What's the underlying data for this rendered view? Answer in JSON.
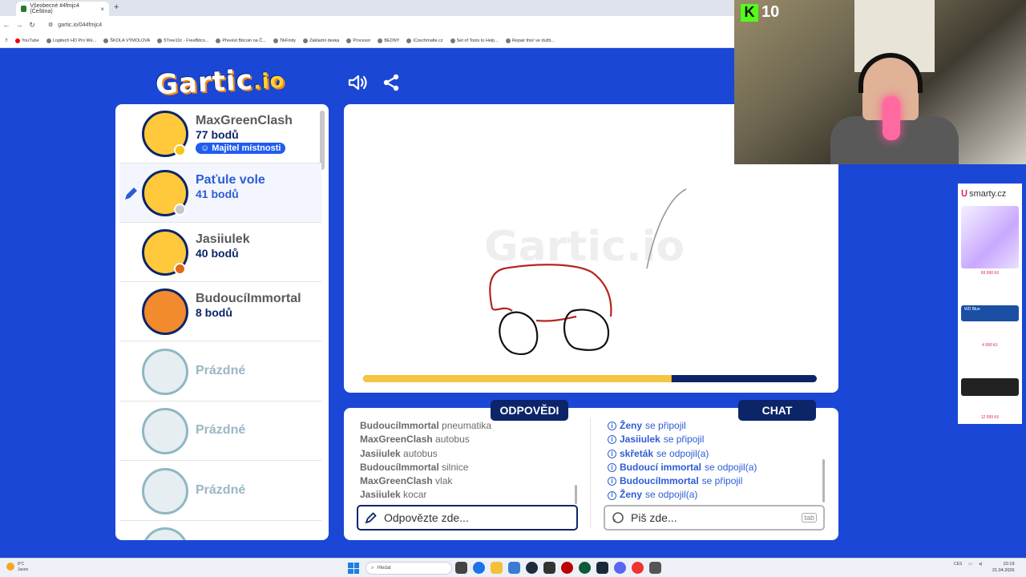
{
  "browser": {
    "tab_title": "Všeobecné #4fmjc4 (Čeština)",
    "url": "gartic.io/044fmjc4",
    "bookmarks": [
      "YouTube",
      "Logitech HD Pro We...",
      "ŠKOLA VÝMOLOVA",
      "5Tree10c - FreeBitco...",
      "Převést Bitcoin na Č...",
      "TikFinity",
      "Základní deska",
      "Procesor",
      "BEDNY",
      "iCzechmafie.cz",
      "Set of Tools to Help...",
      "Repair this! ve dužb..."
    ]
  },
  "logo": {
    "main": "Gartic",
    "suffix": ".io"
  },
  "players": [
    {
      "name": "MaxGreenClash",
      "points": "77 bodů",
      "badge": "Majitel místnosti",
      "status_color": "#f5c518",
      "avatar_color": "#ffc93b"
    },
    {
      "name": "Paťule vole",
      "points": "41 bodů",
      "status_color": "#c8c8c8",
      "avatar_color": "#ffc93b",
      "drawing": true
    },
    {
      "name": "Jasiiulek",
      "points": "40 bodů",
      "status_color": "#e06a16",
      "avatar_color": "#ffc93b"
    },
    {
      "name": "BudoucíImmortal",
      "points": "8 bodů",
      "avatar_color": "#f28a2e"
    },
    {
      "name": "Prázdné"
    },
    {
      "name": "Prázdné"
    },
    {
      "name": "Prázdné"
    }
  ],
  "canvas": {
    "watermark": "Gartic.io",
    "timer_progress": 0.68
  },
  "answers": {
    "title": "ODPOVĚDI",
    "messages": [
      {
        "who": "BudoucíImmortal",
        "what": "pneumatika"
      },
      {
        "who": "MaxGreenClash",
        "what": "autobus"
      },
      {
        "who": "Jasiiulek",
        "what": "autobus"
      },
      {
        "who": "BudoucíImmortal",
        "what": "silnice"
      },
      {
        "who": "MaxGreenClash",
        "what": "vlak"
      },
      {
        "who": "Jasiiulek",
        "what": "kocar"
      }
    ],
    "placeholder": "Odpovězte zde..."
  },
  "chat": {
    "title": "CHAT",
    "messages": [
      {
        "who": "Ženy",
        "what": "se připojil"
      },
      {
        "who": "Jasiiulek",
        "what": "se připojil"
      },
      {
        "who": "skřeták",
        "what": "se odpojil(a)"
      },
      {
        "who": "Budoucí immortal",
        "what": "se odpojil(a)"
      },
      {
        "who": "BudoucíImmortal",
        "what": "se připojil"
      },
      {
        "who": "Ženy",
        "what": "se odpojil(a)"
      }
    ],
    "placeholder": "Piš zde...",
    "tab_hint": "tab"
  },
  "webcam": {
    "kick_count": "10"
  },
  "ad": {
    "brand": "smarty.cz",
    "prices": [
      "69 990 Kč",
      "4 990 Kč",
      "12 999 Kč"
    ],
    "ssd_label": "WD Blue"
  },
  "taskbar": {
    "weather_temp": "8°C",
    "weather_text": "Jasno",
    "search": "Hledat",
    "lang": "CES",
    "time": "22:19",
    "date": "21.04.2026"
  },
  "colors": {
    "background": "#1a47d6",
    "navy": "#0c2569",
    "accent_blue": "#2b5cd6",
    "timer_yellow": "#f5c542"
  }
}
